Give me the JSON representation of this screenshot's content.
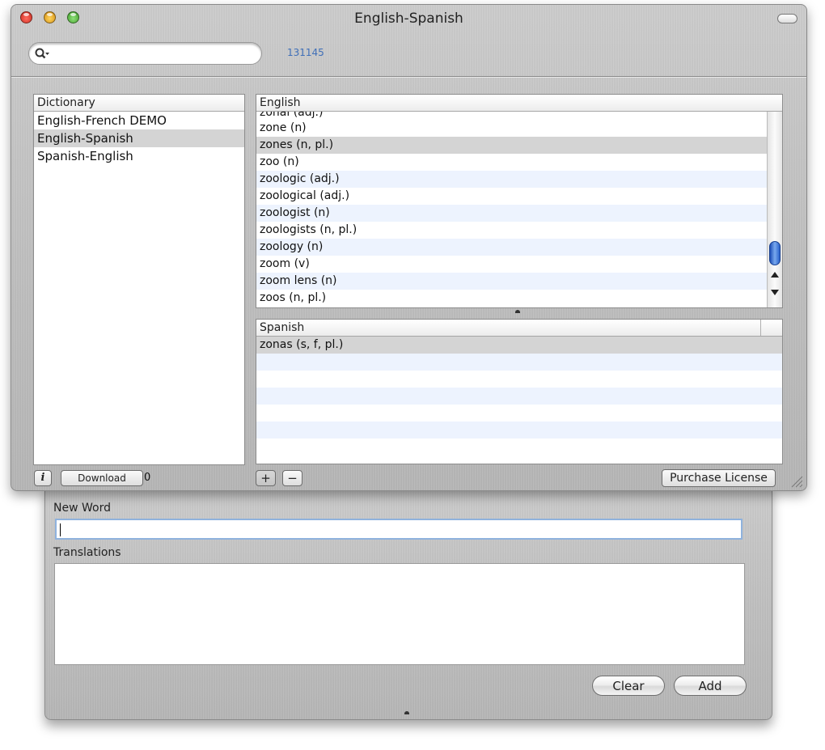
{
  "window": {
    "title": "English-Spanish"
  },
  "search": {
    "value": "",
    "placeholder": "",
    "count": "131145"
  },
  "dictionary": {
    "header": "Dictionary",
    "items": [
      {
        "label": "English-French DEMO",
        "selected": false
      },
      {
        "label": "English-Spanish",
        "selected": true
      },
      {
        "label": "Spanish-English",
        "selected": false
      }
    ]
  },
  "english": {
    "header": "English",
    "partial_top_row": "zonal (adj.)",
    "items": [
      {
        "label": "zone (n)",
        "selected": false
      },
      {
        "label": "zones (n, pl.)",
        "selected": true
      },
      {
        "label": "zoo (n)",
        "selected": false
      },
      {
        "label": "zoologic (adj.)",
        "selected": false
      },
      {
        "label": "zoological (adj.)",
        "selected": false
      },
      {
        "label": "zoologist (n)",
        "selected": false
      },
      {
        "label": "zoologists (n, pl.)",
        "selected": false
      },
      {
        "label": "zoology (n)",
        "selected": false
      },
      {
        "label": "zoom (v)",
        "selected": false
      },
      {
        "label": "zoom lens (n)",
        "selected": false
      },
      {
        "label": "zoos (n, pl.)",
        "selected": false
      }
    ]
  },
  "spanish": {
    "header": "Spanish",
    "items": [
      {
        "label": "zonas (s, f, pl.)",
        "selected": true
      }
    ]
  },
  "bottom_bar": {
    "info_label": "i",
    "download_label": "Download",
    "download_suffix": "0",
    "add_label": "+",
    "remove_label": "−",
    "purchase_label": "Purchase License"
  },
  "drawer": {
    "new_word_label": "New Word",
    "new_word_value": "",
    "translations_label": "Translations",
    "translations_value": "",
    "clear_label": "Clear",
    "add_label": "Add"
  },
  "colors": {
    "accent_blue": "#3f6fb8",
    "row_alt": "#edf3fe",
    "row_selected": "#d4d4d4"
  }
}
